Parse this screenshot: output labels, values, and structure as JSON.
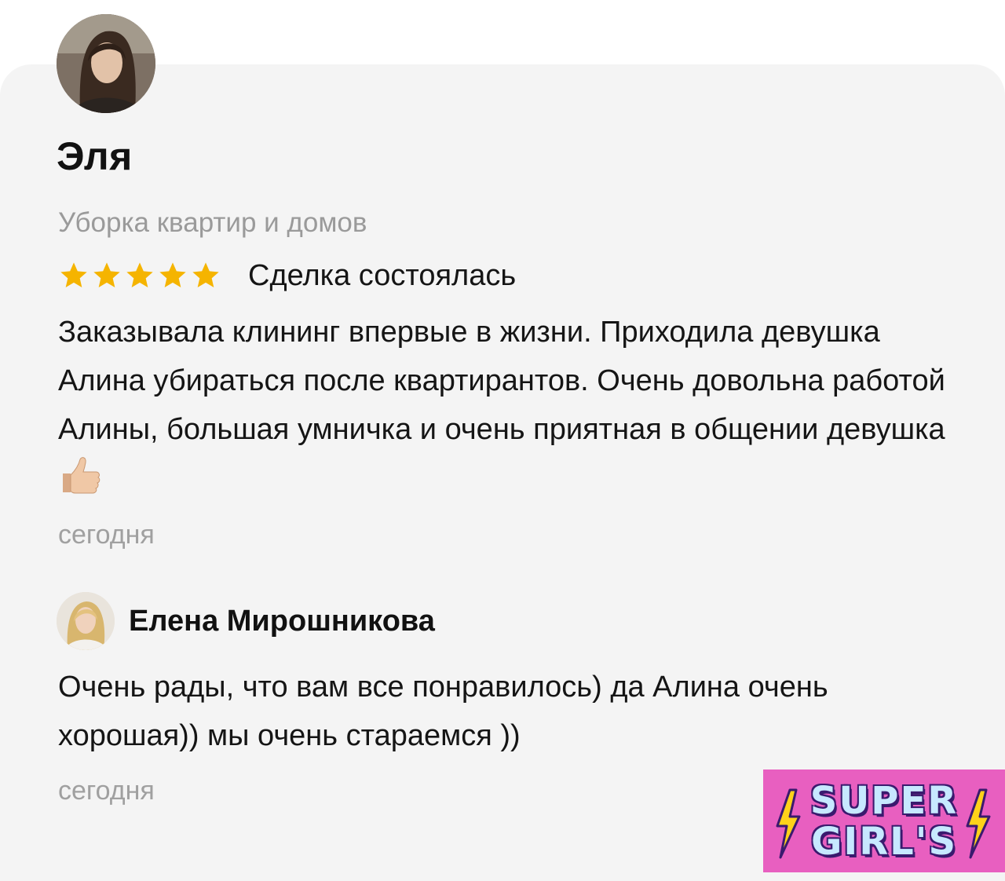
{
  "review": {
    "author": "Эля",
    "service": "Уборка квартир и домов",
    "rating": 5,
    "rating_max": 5,
    "status": "Сделка состоялась",
    "text": "Заказывала клининг впервые в жизни. Приходила девушка Алина убираться после квартирантов. Очень довольна работой Алины, большая умничка и очень приятная в общении девушка",
    "date": "сегодня"
  },
  "reply": {
    "author": "Елена Мирошникова",
    "text": "Очень рады, что вам все понравилось) да Алина очень хорошая)) мы очень стараемся ))",
    "date": "сегодня"
  },
  "logo": {
    "line1": "SUPER",
    "line2": "GIRL'S"
  },
  "colors": {
    "star": "#f5b400",
    "card_bg": "#f4f4f4",
    "logo_bg": "#e85fc0",
    "bolt": "#ffd21a"
  },
  "icons": {
    "star": "star-icon",
    "thumbs_up": "thumbs-up-icon",
    "bolt": "lightning-bolt-icon"
  }
}
